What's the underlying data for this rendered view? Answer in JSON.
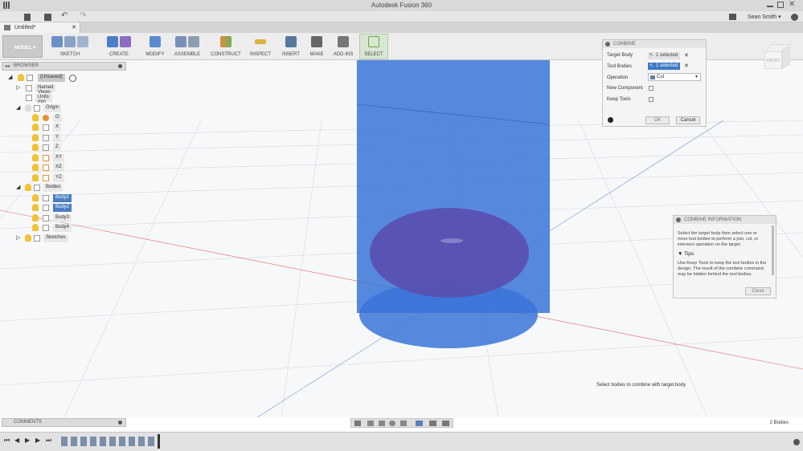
{
  "app": {
    "title": "Autodesk Fusion 360"
  },
  "user": {
    "name": "Sean Smith ▾"
  },
  "document": {
    "tab_title": "Untitled*"
  },
  "ribbon": {
    "workspace": "MODEL",
    "groups": [
      "SKETCH",
      "CREATE",
      "MODIFY",
      "ASSEMBLE",
      "CONSTRUCT",
      "INSPECT",
      "INSERT",
      "MAKE",
      "ADD-INS",
      "SELECT"
    ]
  },
  "browser": {
    "title": "BROWSER",
    "root": "(Unsaved)",
    "named_views": "Named Views",
    "units": "Units: mm",
    "origin": "Origin",
    "origin_items": [
      "O",
      "X",
      "Y",
      "Z",
      "XY",
      "XZ",
      "YZ"
    ],
    "bodies": "Bodies",
    "body_items": [
      "Body1",
      "Body2",
      "Body3",
      "Body4"
    ],
    "sketches": "Sketches"
  },
  "combine_dialog": {
    "title": "COMBINE",
    "target_body_label": "Target Body",
    "target_body_value": "1 selected",
    "tool_bodies_label": "Tool Bodies",
    "tool_bodies_value": "1 selected",
    "operation_label": "Operation",
    "operation_value": "Cut",
    "new_component_label": "New Component",
    "keep_tools_label": "Keep Tools",
    "ok_label": "OK",
    "cancel_label": "Cancel"
  },
  "combine_info": {
    "title": "COMBINE INFORMATION",
    "description": "Select the target body then select one or more tool bodies to perform a join, cut, or intersect operation on the target.",
    "tips_title": "Tips",
    "tips_text": "Use Keep Tools to keep the tool bodies in the design. The result of the combine command may be hidden behind the tool bodies.",
    "close_label": "Close"
  },
  "viewcube": {
    "face_label": "FRONT"
  },
  "status": {
    "message": "Select bodies to combine with target body",
    "body_count": "2 Bodies"
  },
  "comments": {
    "title": "COMMENTS"
  },
  "colors": {
    "accent": "#3d7ac4",
    "cylinder": "#3a74d8",
    "ellipsoid": "#5a4fae",
    "bulb": "#f1c232"
  }
}
